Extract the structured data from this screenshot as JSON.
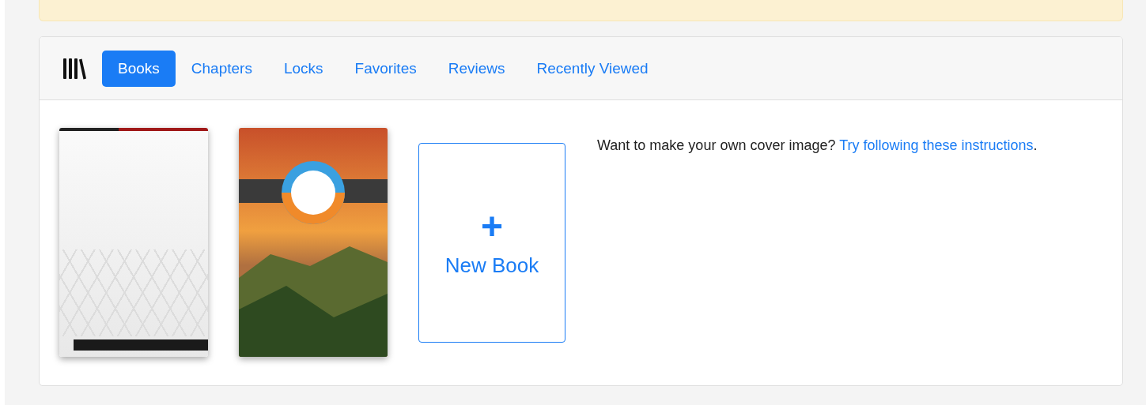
{
  "alert": {
    "visible": true
  },
  "tabs": [
    {
      "label": "Books",
      "selected": true
    },
    {
      "label": "Chapters",
      "selected": false
    },
    {
      "label": "Locks",
      "selected": false
    },
    {
      "label": "Favorites",
      "selected": false
    },
    {
      "label": "Reviews",
      "selected": false
    },
    {
      "label": "Recently Viewed",
      "selected": false
    }
  ],
  "books": [
    {
      "kind": "hexagon"
    },
    {
      "kind": "landscape"
    }
  ],
  "new_book": {
    "icon": "+",
    "label": "New Book"
  },
  "cover_note": {
    "text": "Want to make your own cover image?",
    "link": "Try following these instructions",
    "end": "."
  }
}
